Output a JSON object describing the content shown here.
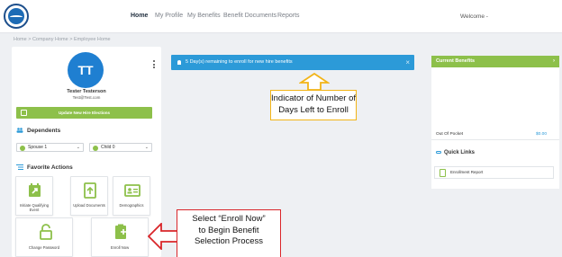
{
  "header": {
    "nav": [
      "Home",
      "My Profile",
      "My Benefits",
      "Benefit Documents",
      "Reports"
    ],
    "active_index": 0,
    "welcome": "Welcome -"
  },
  "breadcrumb": "Home > Company Home > Employee Home",
  "profile": {
    "initials": "TT",
    "name": "Tester Testerson",
    "email": "Test@Test.com",
    "update_button": "Update New Hire Elections"
  },
  "dependents": {
    "title": "Dependents",
    "selects": [
      "Spouse 1",
      "Child 0"
    ]
  },
  "favorite_actions": {
    "title": "Favorite Actions",
    "tiles": [
      "Initiate Qualifying Event",
      "Upload Documents",
      "Demographics",
      "Change Password",
      "Enroll Now"
    ]
  },
  "banner": {
    "text": "5 Day(s) remaining to enroll for new hire benefits",
    "close": "×"
  },
  "current_benefits": {
    "title": "Current Benefits",
    "chevron": "›",
    "oop_label": "Out Of Pocket",
    "oop_value": "$0.00"
  },
  "quick_links": {
    "title": "Quick Links",
    "items": [
      "Enrollment Report"
    ]
  },
  "annotations": {
    "indicator": [
      "Indicator of Number of",
      "Days Left to Enroll"
    ],
    "enroll": [
      "Select “Enroll Now”",
      "to Begin Benefit",
      "Selection Process"
    ]
  },
  "colors": {
    "accent_green": "#8dc04a",
    "accent_blue": "#2c9ad8",
    "avatar_blue": "#1f7fd1",
    "annotation_yellow": "#f2b417",
    "annotation_red": "#d9262a"
  }
}
